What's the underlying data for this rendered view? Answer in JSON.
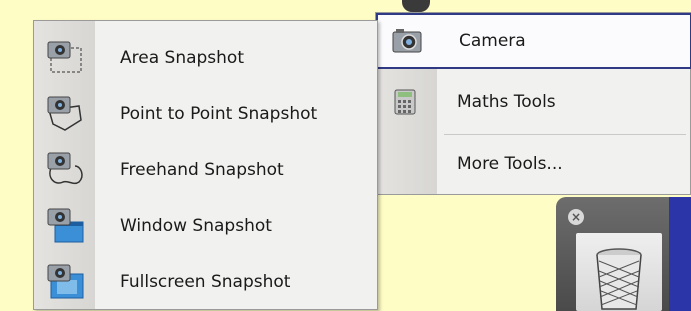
{
  "snapshot_menu": {
    "items": [
      {
        "label": "Area Snapshot",
        "icon": "area-snapshot-icon"
      },
      {
        "label": "Point to Point Snapshot",
        "icon": "point-to-point-snapshot-icon"
      },
      {
        "label": "Freehand Snapshot",
        "icon": "freehand-snapshot-icon"
      },
      {
        "label": "Window Snapshot",
        "icon": "window-snapshot-icon"
      },
      {
        "label": "Fullscreen Snapshot",
        "icon": "fullscreen-snapshot-icon"
      }
    ]
  },
  "tools_menu": {
    "items": [
      {
        "label": "Camera",
        "icon": "camera-icon",
        "selected": true
      },
      {
        "label": "Maths Tools",
        "icon": "calculator-icon"
      },
      {
        "label": "More Tools...",
        "icon": ""
      }
    ]
  },
  "trash": {
    "close_glyph": "×",
    "icon": "trash-bin-icon"
  },
  "colors": {
    "background": "#fefdc5",
    "selection_border": "#2f3a84",
    "menu_bg": "#f1f1ef",
    "accent_band": "#2b35a8"
  }
}
